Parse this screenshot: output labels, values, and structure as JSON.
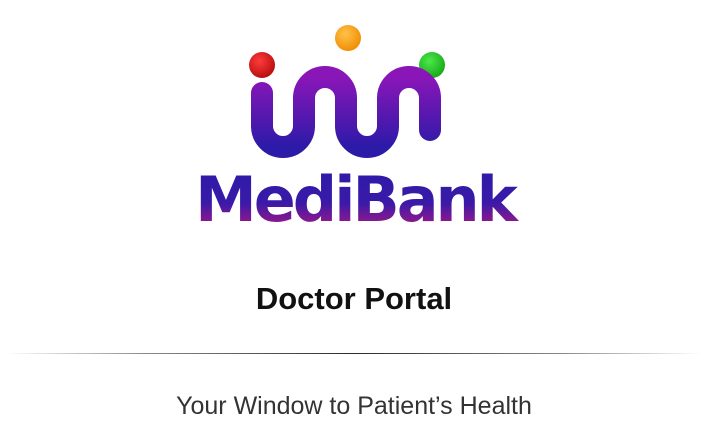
{
  "brand": {
    "name": "MediBank",
    "logo_dot_colors": [
      "#e01818",
      "#f7a21b",
      "#22c422"
    ],
    "gradient_top": "#8a16b8",
    "gradient_bottom": "#2c1aa8",
    "text_gradient_top": "#2c1aa8",
    "text_gradient_bottom": "#c7177a"
  },
  "header": {
    "title": "Doctor Portal"
  },
  "footer": {
    "tagline": "Your Window to Patient’s Health"
  }
}
